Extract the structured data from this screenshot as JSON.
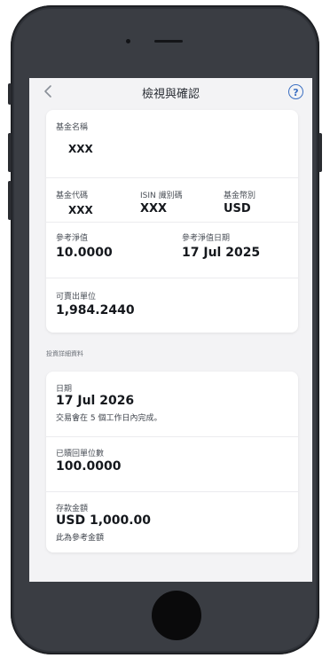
{
  "header": {
    "title": "檢視與確認",
    "back_icon": "chevron-left-icon",
    "help_icon": "question-circle-icon",
    "help_glyph": "?"
  },
  "fund": {
    "name_label": "基金名稱",
    "name_value": "XXX",
    "code_label": "基金代碼",
    "code_value": "XXX",
    "isin_label": "ISIN 識別碼",
    "isin_value": "XXX",
    "currency_label": "基金幣別",
    "currency_value": "USD",
    "nav_label": "參考淨值",
    "nav_value": "10.0000",
    "nav_date_label": "參考淨值日期",
    "nav_date_value": "17 Jul 2025",
    "units_label": "可賣出單位",
    "units_value": "1,984.2440"
  },
  "details": {
    "section_title": "投資詳細資料",
    "date_label": "日期",
    "date_value": "17 Jul 2026",
    "date_note": "交易會在 5 個工作日內完成。",
    "redeemed_label": "已贖回單位數",
    "redeemed_value": "100.0000",
    "amount_label": "存款金額",
    "amount_value": "USD 1,000.00",
    "amount_note": "此為參考金額"
  },
  "colors": {
    "accent": "#3b6fc2",
    "background": "#f3f3f5",
    "card": "#ffffff",
    "phone": "#2f3238"
  }
}
